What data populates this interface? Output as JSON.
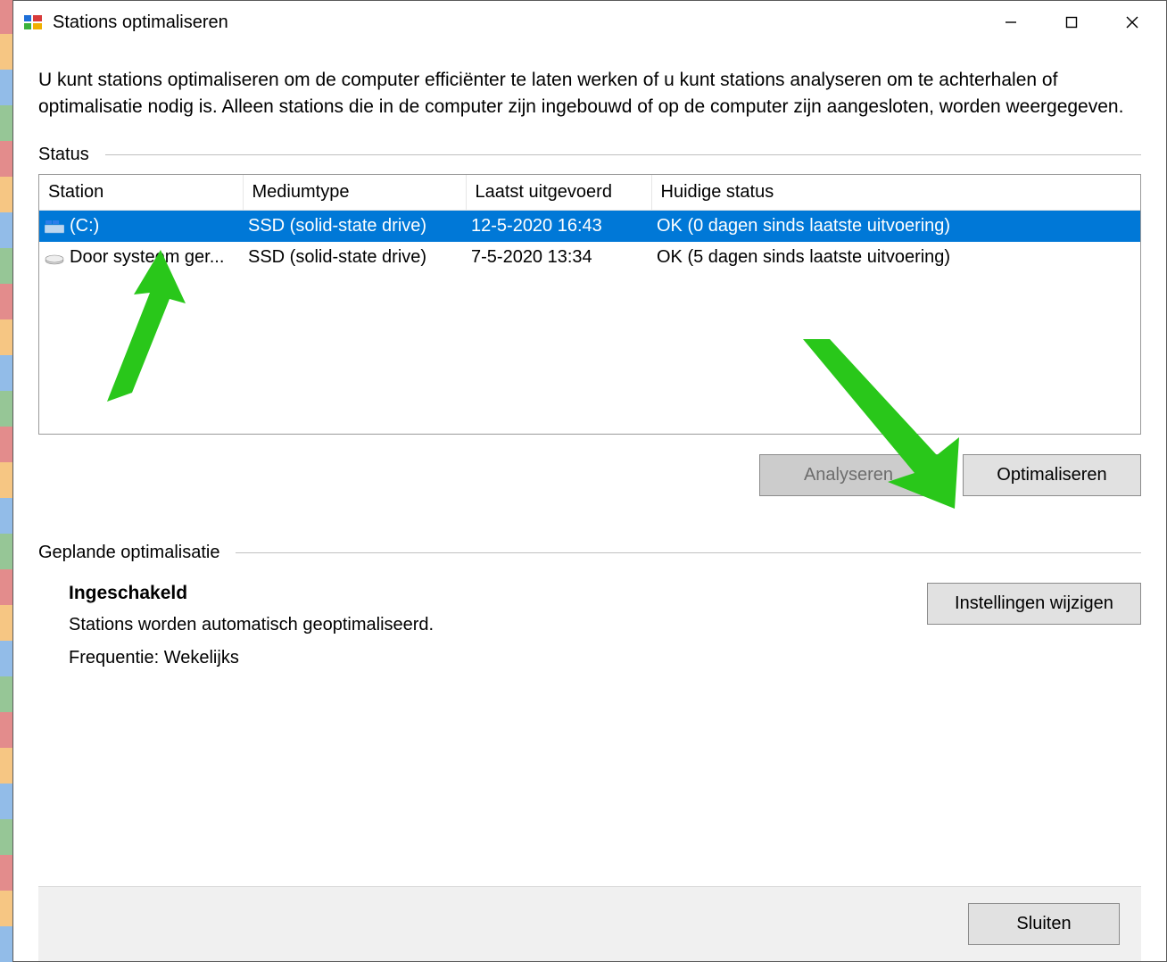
{
  "window": {
    "title": "Stations optimaliseren"
  },
  "description": "U kunt stations optimaliseren om de computer efficiënter te laten werken of u kunt stations analyseren om te achterhalen of optimalisatie nodig is. Alleen stations die in de computer zijn ingebouwd of op de computer zijn aangesloten, worden weergegeven.",
  "status_label": "Status",
  "columns": {
    "station": "Station",
    "medium": "Mediumtype",
    "last": "Laatst uitgevoerd",
    "current_status": "Huidige status"
  },
  "rows": [
    {
      "station": "(C:)",
      "medium": "SSD (solid-state drive)",
      "last": "12-5-2020 16:43",
      "status": "OK (0 dagen sinds laatste uitvoering)",
      "selected": true,
      "icon": "windows-drive"
    },
    {
      "station": "Door systeem ger...",
      "medium": "SSD (solid-state drive)",
      "last": "7-5-2020 13:34",
      "status": "OK (5 dagen sinds laatste uitvoering)",
      "selected": false,
      "icon": "hdd"
    }
  ],
  "buttons": {
    "analyse": "Analyseren",
    "optimise": "Optimaliseren",
    "change_settings": "Instellingen wijzigen",
    "close": "Sluiten"
  },
  "scheduled": {
    "label": "Geplande optimalisatie",
    "enabled": "Ingeschakeld",
    "auto_line": "Stations worden automatisch geoptimaliseerd.",
    "frequency": "Frequentie: Wekelijks"
  }
}
